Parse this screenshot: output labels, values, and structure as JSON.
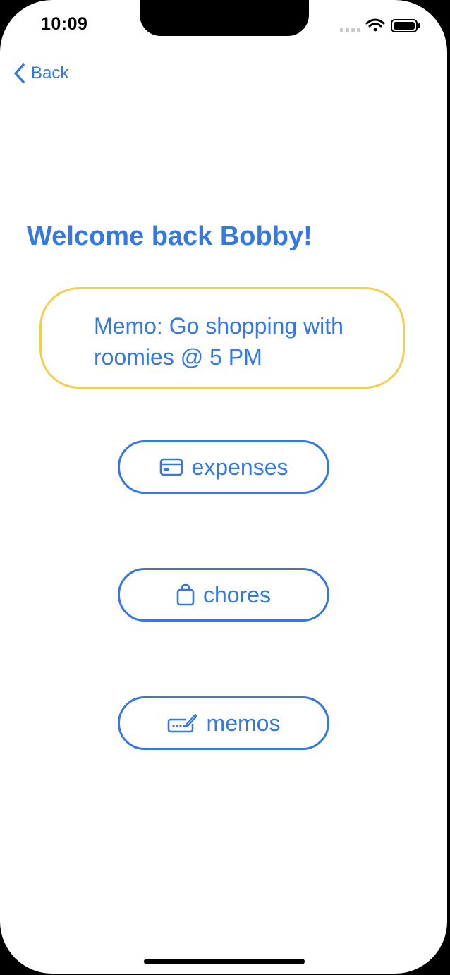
{
  "status_bar": {
    "time": "10:09"
  },
  "nav": {
    "back_label": "Back"
  },
  "welcome": {
    "title": "Welcome back Bobby!"
  },
  "memo": {
    "text": "Memo: Go shopping with roomies @ 5 PM"
  },
  "actions": [
    {
      "label": "expenses",
      "icon": "credit-card-icon"
    },
    {
      "label": "chores",
      "icon": "shopping-bag-icon"
    },
    {
      "label": "memos",
      "icon": "signature-icon"
    }
  ],
  "colors": {
    "accent": "#3478e6",
    "memo_border": "#f5cf4c",
    "background": "#ffffff"
  }
}
